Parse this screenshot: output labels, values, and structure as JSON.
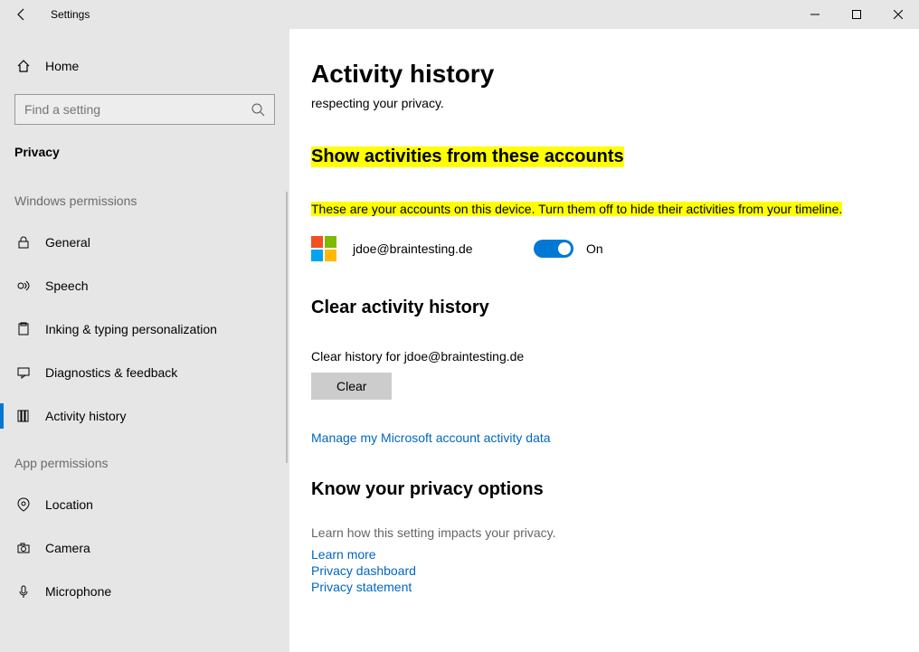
{
  "titlebar": {
    "title": "Settings"
  },
  "sidebar": {
    "home": "Home",
    "search_placeholder": "Find a setting",
    "category": "Privacy",
    "section1": "Windows permissions",
    "items1": [
      "General",
      "Speech",
      "Inking & typing personalization",
      "Diagnostics & feedback",
      "Activity history"
    ],
    "section2": "App permissions",
    "items2": [
      "Location",
      "Camera",
      "Microphone"
    ]
  },
  "main": {
    "title": "Activity history",
    "intro_tail": "respecting your privacy.",
    "accounts_heading": "Show activities from these accounts",
    "accounts_desc": "These are your accounts on this device. Turn them off to hide their activities from your timeline.",
    "account_email": "jdoe@braintesting.de",
    "toggle_state": "On",
    "clear_heading": "Clear activity history",
    "clear_desc": "Clear history for jdoe@braintesting.de",
    "clear_button": "Clear",
    "manage_link": "Manage my Microsoft account activity data",
    "know_heading": "Know your privacy options",
    "know_desc": "Learn how this setting impacts your privacy.",
    "links": [
      "Learn more",
      "Privacy dashboard",
      "Privacy statement"
    ]
  }
}
